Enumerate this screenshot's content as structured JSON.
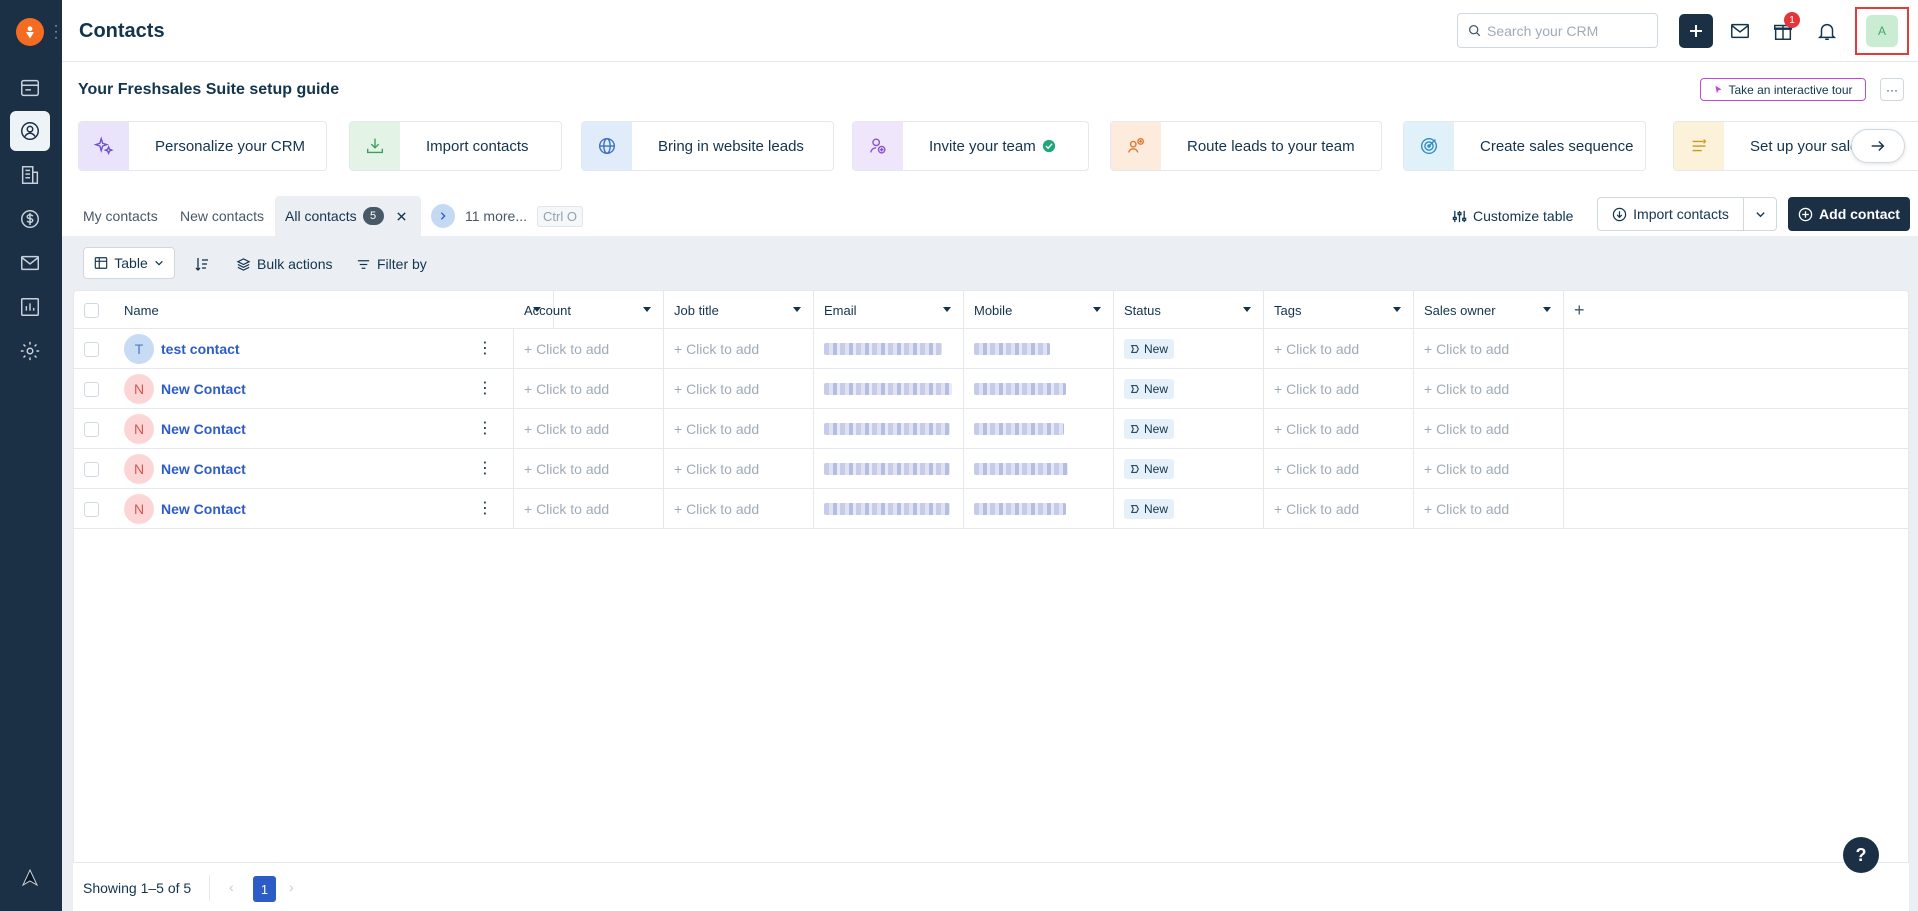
{
  "header": {
    "title": "Contacts",
    "search_placeholder": "Search your CRM",
    "gift_badge": "1",
    "avatar_initial": "A"
  },
  "guide": {
    "title": "Your Freshsales Suite setup guide",
    "tour_label": "Take an interactive tour",
    "more_label": "···",
    "cards": [
      {
        "label": "Personalize your CRM",
        "icon": "sparkle-icon",
        "color": "#e9e4fb"
      },
      {
        "label": "Import contacts",
        "icon": "download-icon",
        "color": "#e3f4e6"
      },
      {
        "label": "Bring in website leads",
        "icon": "globe-icon",
        "color": "#e1ecfa"
      },
      {
        "label": "Invite your team",
        "icon": "user-add-icon",
        "color": "#efe6fb",
        "completed": true
      },
      {
        "label": "Route leads to your team",
        "icon": "route-icon",
        "color": "#fdebdd"
      },
      {
        "label": "Create sales sequence",
        "icon": "target-icon",
        "color": "#e0f1fa"
      },
      {
        "label": "Set up your sales",
        "icon": "lines-icon",
        "color": "#fbf2d9"
      }
    ]
  },
  "views": {
    "my_contacts": "My contacts",
    "new_contacts": "New contacts",
    "all_contacts": "All contacts",
    "all_count": "5",
    "more": "11 more...",
    "shortcut": "Ctrl O"
  },
  "actions": {
    "customize": "Customize table",
    "import": "Import contacts",
    "add": "Add contact"
  },
  "toolbar": {
    "view_mode": "Table",
    "bulk": "Bulk actions",
    "filter": "Filter by"
  },
  "table": {
    "columns": [
      "Name",
      "Account",
      "Job title",
      "Email",
      "Mobile",
      "Status",
      "Tags",
      "Sales owner"
    ],
    "placeholder": "+ Click to add",
    "rows": [
      {
        "initial": "T",
        "name": "test contact",
        "status": "New"
      },
      {
        "initial": "N",
        "name": "New Contact",
        "status": "New"
      },
      {
        "initial": "N",
        "name": "New Contact",
        "status": "New"
      },
      {
        "initial": "N",
        "name": "New Contact",
        "status": "New"
      },
      {
        "initial": "N",
        "name": "New Contact",
        "status": "New"
      }
    ]
  },
  "footer": {
    "showing": "Showing 1–5 of 5",
    "page": "1",
    "help": "?"
  },
  "colors": {
    "sidebar": "#1b2f45",
    "brand_orange": "#f36c21",
    "link_blue": "#2c5cc5",
    "highlight_red": "#e23b3b"
  }
}
